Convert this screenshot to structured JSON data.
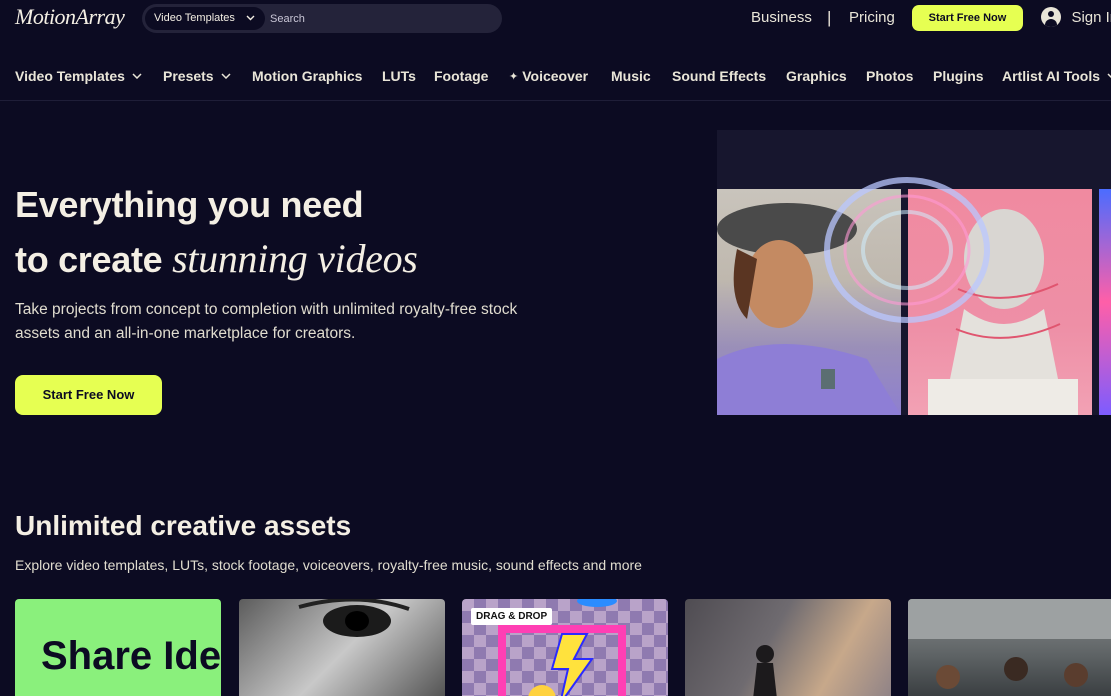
{
  "header": {
    "logo_text": "MotionArray",
    "search": {
      "category": "Video Templates",
      "placeholder": "Search",
      "value": ""
    },
    "links": {
      "business": "Business",
      "separator": "|",
      "pricing": "Pricing"
    },
    "cta_label": "Start Free Now",
    "signin_label": "Sign In"
  },
  "nav": {
    "items": [
      {
        "label": "Video Templates",
        "dropdown": true
      },
      {
        "label": "Presets",
        "dropdown": true
      },
      {
        "label": "Motion Graphics"
      },
      {
        "label": "LUTs"
      },
      {
        "label": "Footage"
      },
      {
        "label": "Voiceover",
        "icon": "sparkle-icon"
      },
      {
        "label": "Music"
      },
      {
        "label": "Sound Effects"
      },
      {
        "label": "Graphics"
      },
      {
        "label": "Photos"
      },
      {
        "label": "Plugins"
      },
      {
        "label": "Artlist AI Tools",
        "dropdown": true
      }
    ]
  },
  "hero": {
    "title_line1": "Everything you need",
    "title_line2_plain": "to create ",
    "title_line2_serif": "stunning videos",
    "subtitle": "Take projects from concept to completion with unlimited royalty-free stock assets and an all-in-one marketplace for creators.",
    "cta_label": "Start Free Now"
  },
  "assets_section": {
    "title": "Unlimited creative assets",
    "subtitle": "Explore video templates, LUTs, stock footage, voiceovers, royalty-free music, sound effects and more",
    "cards": [
      {
        "text": "Share Ideas"
      },
      {},
      {
        "badge": "DRAG & DROP"
      },
      {},
      {}
    ]
  },
  "colors": {
    "background": "#0c0b22",
    "accent": "#e6ff52",
    "text": "#f4efe4"
  }
}
